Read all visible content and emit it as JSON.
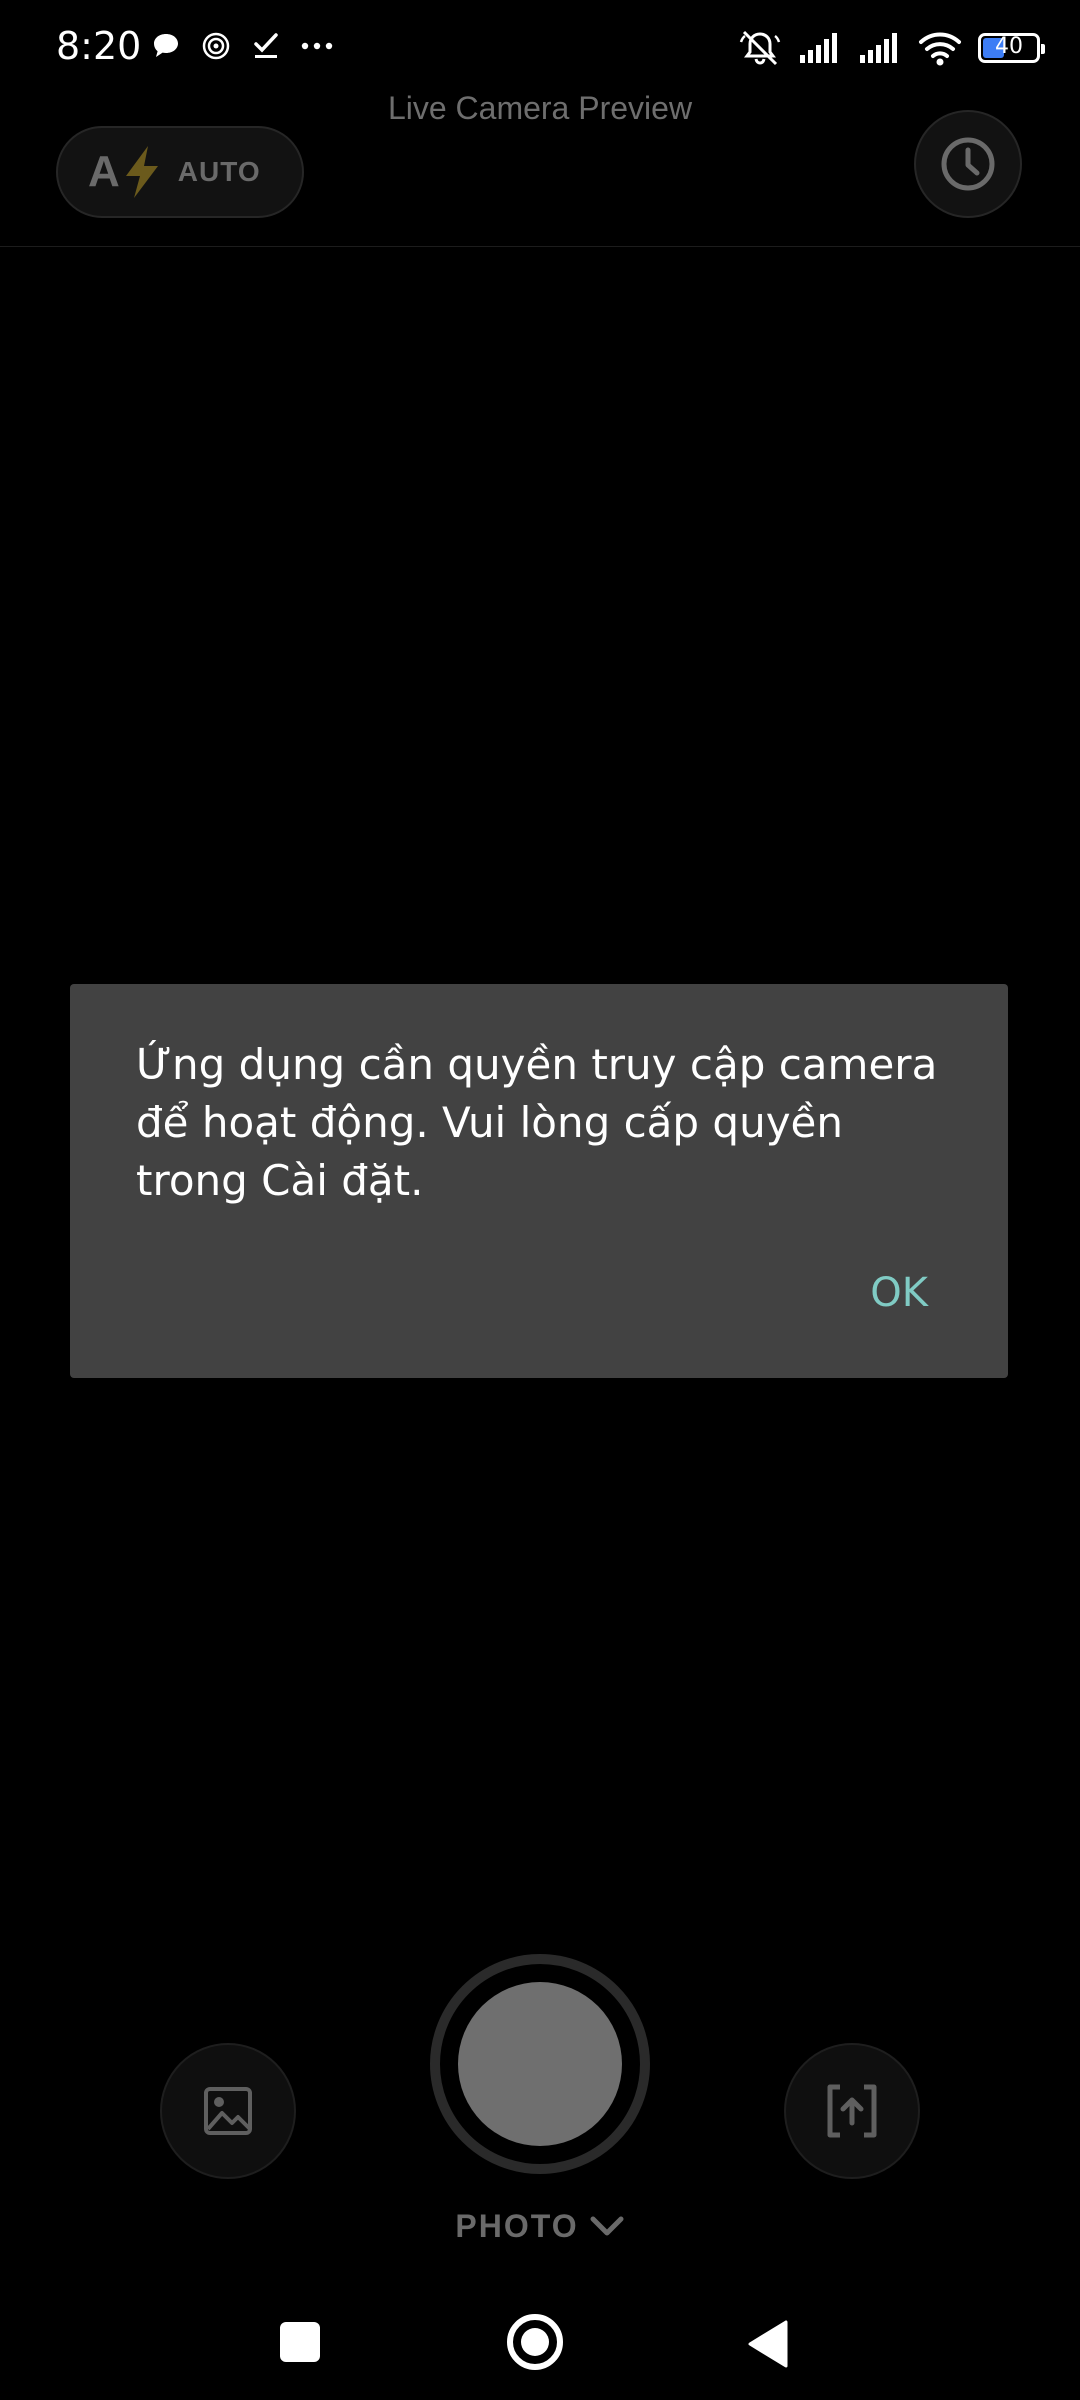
{
  "status_bar": {
    "time": "8:20",
    "battery_level": "40",
    "battery_fraction": 0.4,
    "icons_left": [
      "chat-bubble-icon",
      "spiral-icon",
      "check-icon",
      "more-dots-icon"
    ],
    "icons_right": [
      "muted-bell-icon",
      "signal-bars-icon",
      "signal-bars-icon",
      "wifi-icon",
      "battery-icon"
    ]
  },
  "top_bar": {
    "preview_label": "Live Camera Preview",
    "flash": {
      "letter": "A",
      "mode_label": "AUTO",
      "icon": "lightning-bolt-icon",
      "bolt_color": "#6b5a1c"
    },
    "history_icon": "clock-icon"
  },
  "dialog": {
    "message": "Ứng dụng cần quyền truy cập camera để hoạt động. Vui lòng cấp quyền trong Cài đặt.",
    "ok_label": "OK",
    "background": "#424242",
    "accent": "#80cbc4"
  },
  "controls": {
    "gallery_icon": "image-icon",
    "switch_icon": "switch-camera-icon",
    "mode_label": "PHOTO",
    "mode_icon": "chevron-down-icon"
  },
  "nav_bar": {
    "icons": [
      "recents-icon",
      "home-icon",
      "back-icon"
    ]
  }
}
